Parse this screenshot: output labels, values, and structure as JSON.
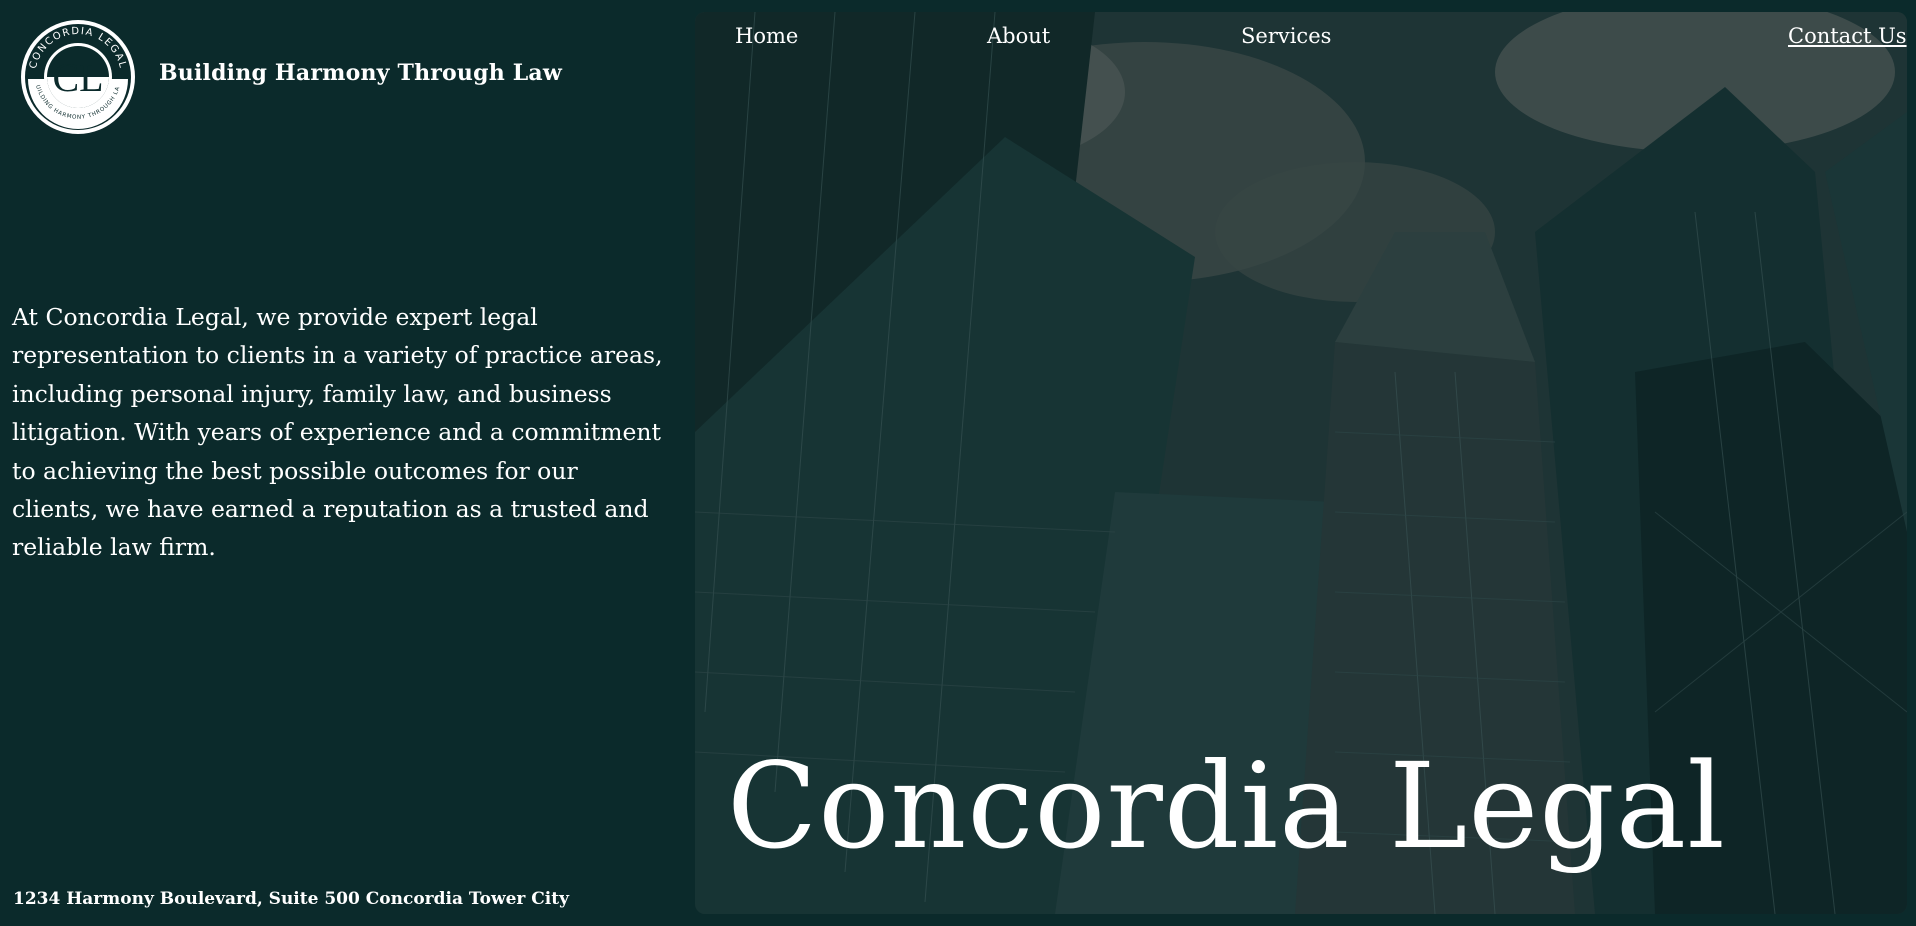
{
  "brand": {
    "logo_ring_text": "CONCORDIA LEGAL",
    "logo_ring_bottom": "BUILDING HARMONY THROUGH LAW",
    "logo_monogram": "CL",
    "tagline": "Building Harmony Through Law"
  },
  "intro": {
    "text": "At Concordia Legal, we provide expert legal representation to clients in a variety of practice areas, including personal injury, family law, and business litigation. With years of experience and a commitment to achieving the best possible outcomes for our clients, we have earned a reputation as a trusted and reliable law firm."
  },
  "footer": {
    "address": "1234 Harmony Boulevard, Suite 500 Concordia Tower City"
  },
  "nav": {
    "home": "Home",
    "about": "About",
    "services": "Services",
    "contact": "Contact Us"
  },
  "hero": {
    "title": "Concordia Legal"
  },
  "colors": {
    "background": "#0b2a2b",
    "text": "#ffffff"
  }
}
